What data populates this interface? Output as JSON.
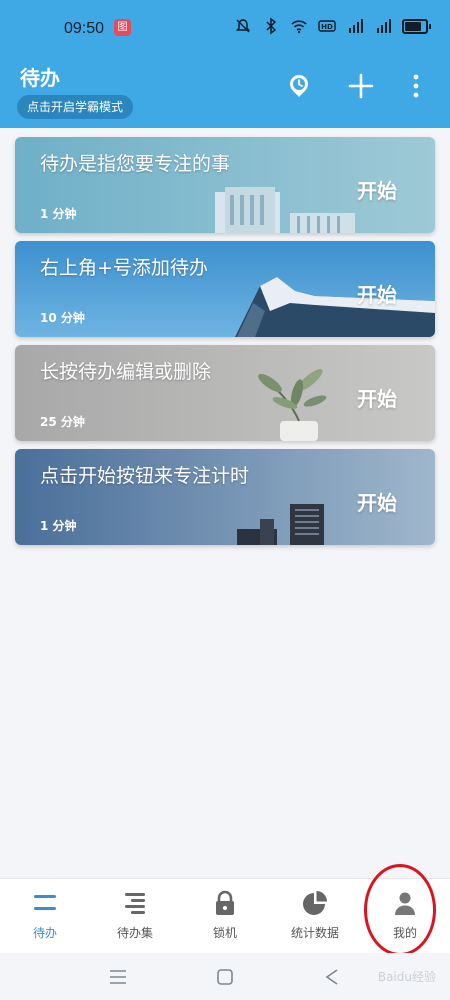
{
  "status_bar": {
    "time": "09:50",
    "badge_text": "图",
    "icons": [
      "mute-icon",
      "bluetooth-icon",
      "wifi-icon",
      "hd-icon",
      "signal-5g-icon",
      "signal-4g-icon",
      "battery-icon"
    ]
  },
  "header": {
    "title": "待办",
    "mode_chip": "点击开启学霸模式",
    "icons": [
      "clock-icon",
      "plus-icon",
      "more-vert-icon"
    ]
  },
  "tasks": [
    {
      "title": "待办是指您要专注的事",
      "duration": "1 分钟",
      "start_label": "开始"
    },
    {
      "title": "右上角+号添加待办",
      "duration": "10 分钟",
      "start_label": "开始"
    },
    {
      "title": "长按待办编辑或删除",
      "duration": "25 分钟",
      "start_label": "开始"
    },
    {
      "title": "点击开始按钮来专注计时",
      "duration": "1 分钟",
      "start_label": "开始"
    }
  ],
  "tabs": [
    {
      "label": "待办",
      "icon": "todo-icon",
      "active": true
    },
    {
      "label": "待办集",
      "icon": "todo-set-icon",
      "active": false
    },
    {
      "label": "锁机",
      "icon": "lock-icon",
      "active": false
    },
    {
      "label": "统计数据",
      "icon": "pie-chart-icon",
      "active": false
    },
    {
      "label": "我的",
      "icon": "user-icon",
      "active": false
    }
  ],
  "colors": {
    "header_bg": "#3fa9e6",
    "accent": "#3a8ed0",
    "highlight_ring": "#d9151e"
  },
  "watermark": "Baidu经验"
}
